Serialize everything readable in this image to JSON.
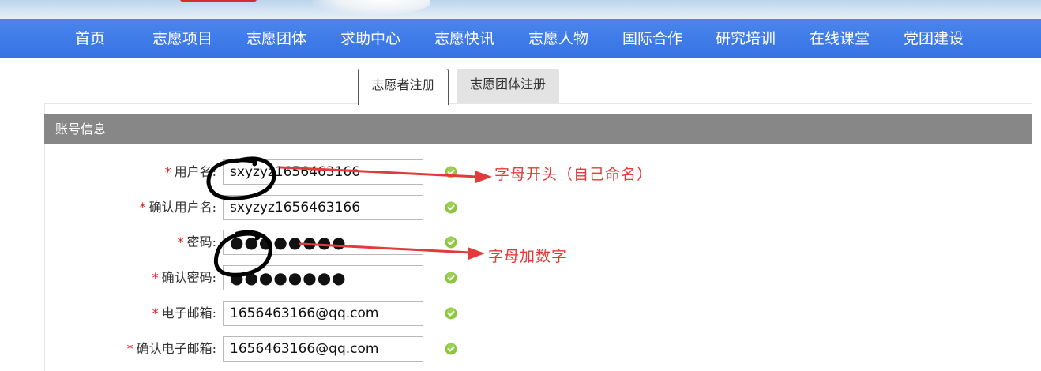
{
  "nav": {
    "items": [
      "首页",
      "志愿项目",
      "志愿团体",
      "求助中心",
      "志愿快讯",
      "志愿人物",
      "国际合作",
      "研究培训",
      "在线课堂",
      "党团建设"
    ]
  },
  "tabs": {
    "volunteer": "志愿者注册",
    "group": "志愿团体注册"
  },
  "section": {
    "title": "账号信息"
  },
  "form": {
    "required_mark": "*",
    "username_label": "用户名:",
    "username_value": "sxyzyz1656463166",
    "confirm_username_label": "确认用户名:",
    "confirm_username_value": "sxyzyz1656463166",
    "password_label": "密码:",
    "password_value": "●●●●●●●●",
    "confirm_password_label": "确认密码:",
    "confirm_password_value": "●●●●●●●●",
    "email_label": "电子邮箱:",
    "email_value": "1656463166@qq.com",
    "confirm_email_label": "确认电子邮箱:",
    "confirm_email_value": "1656463166@qq.com"
  },
  "annotations": {
    "username_note": "字母开头（自己命名）",
    "password_note": "字母加数字",
    "color": "#e33b3b"
  },
  "colors": {
    "nav_bg": "#3d7ae6",
    "section_header_bg": "#878787",
    "valid_check": "#8cc63f"
  }
}
